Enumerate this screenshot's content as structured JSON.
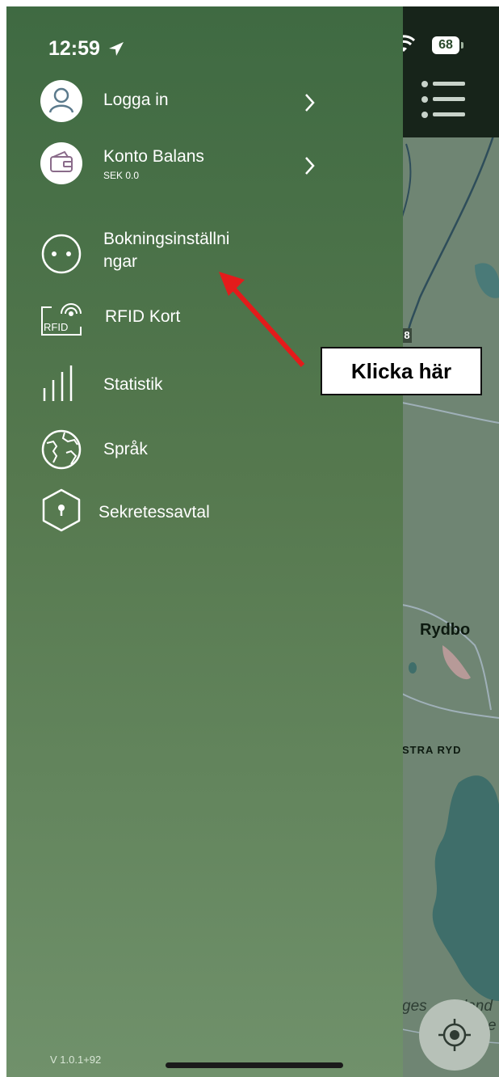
{
  "status_bar": {
    "time": "12:59",
    "battery": "68"
  },
  "menu": {
    "login": {
      "label": "Logga in"
    },
    "balance": {
      "label": "Konto Balans",
      "sub": "SEK 0.0"
    },
    "booking_settings": {
      "label_line1": "Bokningsinställni",
      "label_line2": "ngar"
    },
    "rfid": {
      "label": "RFID Kort",
      "icon_text": "RFID"
    },
    "statistics": {
      "label": "Statistik"
    },
    "language": {
      "label": "Språk"
    },
    "privacy": {
      "label": "Sekretessavtal"
    }
  },
  "version": "V 1.0.1+92",
  "map": {
    "road_marker": "8",
    "place_rydbo": "Rydbo",
    "place_stra_ryd": "STRA RYD",
    "place_partial_1": "ges",
    "place_partial_2": "land",
    "place_partial_3": "e"
  },
  "annotation": {
    "text": "Klicka här"
  },
  "colors": {
    "drawer_top": "#3f6a42",
    "drawer_bottom": "#70916b",
    "arrow": "#e31b1b",
    "water": "#3f6e6a"
  }
}
